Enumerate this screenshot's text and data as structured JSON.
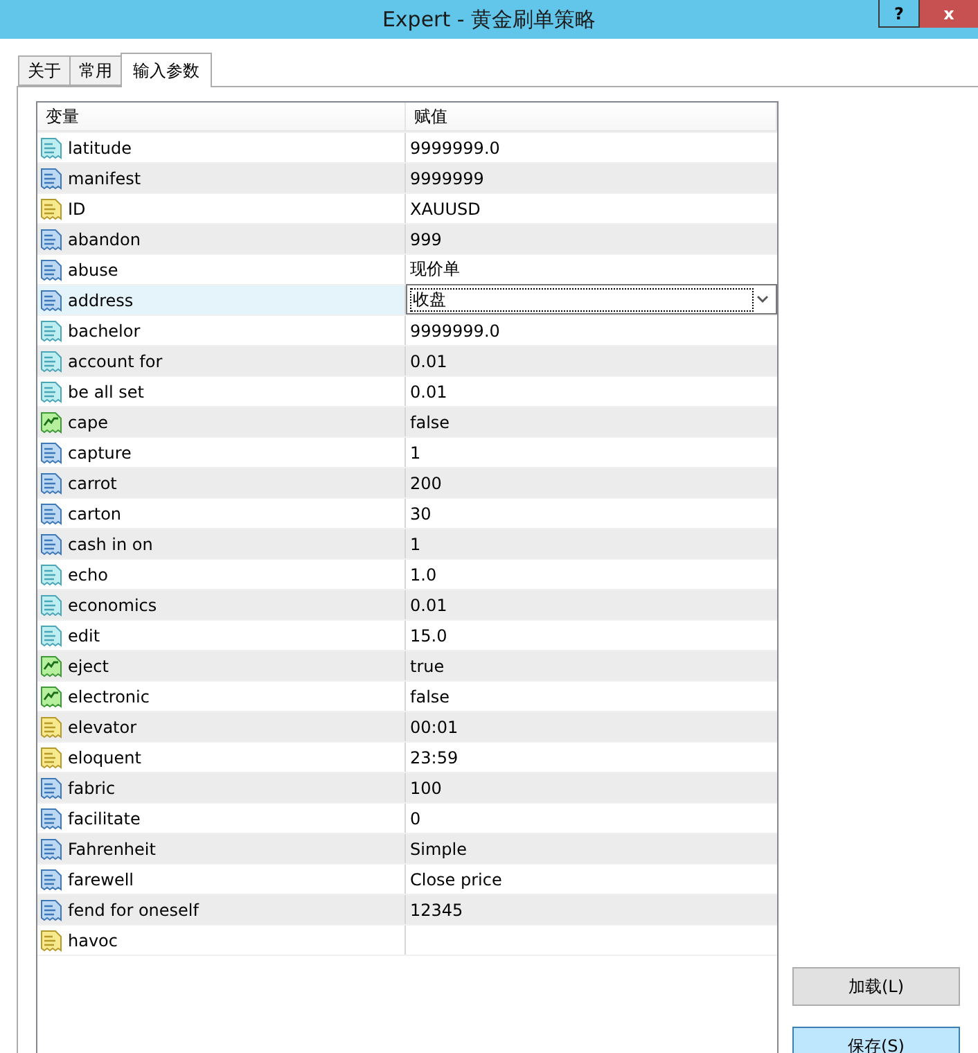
{
  "window": {
    "title": "Expert - 黄金刷单策略",
    "help_button": "?",
    "close_button": "x"
  },
  "tabs": [
    {
      "label": "关于",
      "selected": false
    },
    {
      "label": "常用",
      "selected": false
    },
    {
      "label": "输入参数",
      "selected": true
    }
  ],
  "table": {
    "columns": [
      "变量",
      "赋值"
    ],
    "rows": [
      {
        "kind": "double",
        "name": "latitude",
        "value": "9999999.0",
        "selected": false
      },
      {
        "kind": "int",
        "name": "manifest",
        "value": "9999999",
        "selected": false
      },
      {
        "kind": "string",
        "name": "ID",
        "value": "XAUUSD",
        "selected": false
      },
      {
        "kind": "int",
        "name": "abandon",
        "value": "999",
        "selected": false
      },
      {
        "kind": "int",
        "name": "abuse",
        "value": "现价单",
        "selected": false
      },
      {
        "kind": "int",
        "name": "address",
        "value": "收盘",
        "selected": true
      },
      {
        "kind": "double",
        "name": "bachelor",
        "value": "9999999.0",
        "selected": false
      },
      {
        "kind": "double",
        "name": "account for",
        "value": "0.01",
        "selected": false
      },
      {
        "kind": "double",
        "name": "be all set",
        "value": "0.01",
        "selected": false
      },
      {
        "kind": "bool",
        "name": "cape",
        "value": "false",
        "selected": false
      },
      {
        "kind": "int",
        "name": "capture",
        "value": "1",
        "selected": false
      },
      {
        "kind": "int",
        "name": "carrot",
        "value": "200",
        "selected": false
      },
      {
        "kind": "int",
        "name": "carton",
        "value": "30",
        "selected": false
      },
      {
        "kind": "int",
        "name": "cash in on",
        "value": "1",
        "selected": false
      },
      {
        "kind": "double",
        "name": "echo",
        "value": "1.0",
        "selected": false
      },
      {
        "kind": "double",
        "name": "economics",
        "value": "0.01",
        "selected": false
      },
      {
        "kind": "double",
        "name": "edit",
        "value": "15.0",
        "selected": false
      },
      {
        "kind": "bool",
        "name": "eject",
        "value": "true",
        "selected": false
      },
      {
        "kind": "bool",
        "name": "electronic",
        "value": "false",
        "selected": false
      },
      {
        "kind": "string",
        "name": "elevator",
        "value": "00:01",
        "selected": false
      },
      {
        "kind": "string",
        "name": "eloquent",
        "value": "23:59",
        "selected": false
      },
      {
        "kind": "int",
        "name": "fabric",
        "value": "100",
        "selected": false
      },
      {
        "kind": "int",
        "name": "facilitate",
        "value": "0",
        "selected": false
      },
      {
        "kind": "int",
        "name": "Fahrenheit",
        "value": "Simple",
        "selected": false
      },
      {
        "kind": "int",
        "name": "farewell",
        "value": "Close price",
        "selected": false
      },
      {
        "kind": "int",
        "name": "fend for oneself",
        "value": "12345",
        "selected": false
      },
      {
        "kind": "string",
        "name": "havoc",
        "selected": false
      }
    ]
  },
  "buttons": [
    {
      "label": "加载(L)",
      "kind": "normal"
    },
    {
      "label": "保存(S)",
      "kind": "default"
    }
  ]
}
